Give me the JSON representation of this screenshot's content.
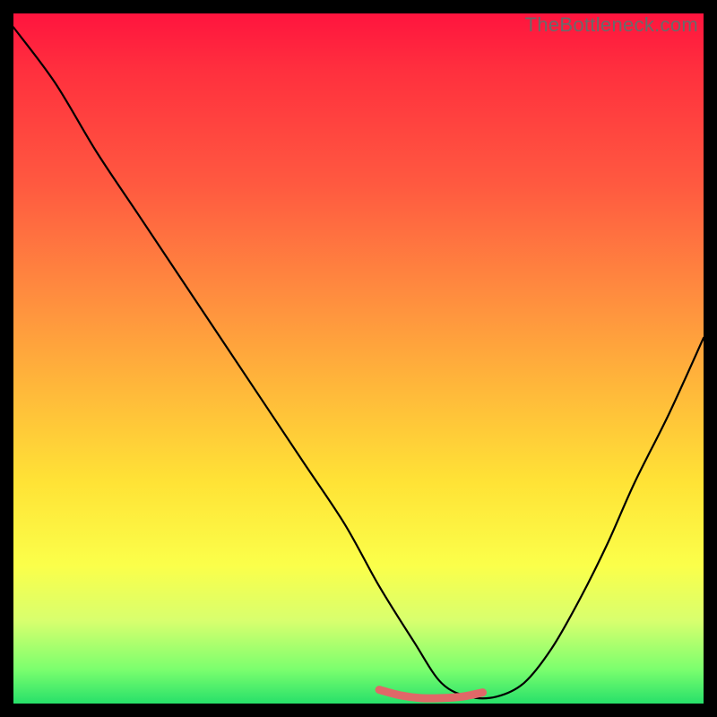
{
  "watermark": "TheBottleneck.com",
  "chart_data": {
    "type": "line",
    "title": "",
    "xlabel": "",
    "ylabel": "",
    "xlim": [
      0,
      100
    ],
    "ylim": [
      0,
      100
    ],
    "grid": false,
    "legend": false,
    "series": [
      {
        "name": "bottleneck-curve",
        "color": "#000000",
        "x": [
          0,
          6,
          12,
          18,
          24,
          30,
          36,
          42,
          48,
          53,
          58,
          62,
          66,
          70,
          74,
          78,
          82,
          86,
          90,
          95,
          100
        ],
        "values": [
          98,
          90,
          80,
          71,
          62,
          53,
          44,
          35,
          26,
          17,
          9,
          3,
          1,
          1,
          3,
          8,
          15,
          23,
          32,
          42,
          53
        ]
      },
      {
        "name": "optimal-basin",
        "color": "#e06868",
        "x": [
          53,
          56,
          59,
          62,
          65,
          68
        ],
        "values": [
          2,
          1.2,
          0.8,
          0.8,
          1.0,
          1.6
        ]
      }
    ],
    "gradient_stops": [
      {
        "pos": 0.0,
        "color": "#ff143e"
      },
      {
        "pos": 0.08,
        "color": "#ff2f3e"
      },
      {
        "pos": 0.25,
        "color": "#ff5a40"
      },
      {
        "pos": 0.4,
        "color": "#ff8a3f"
      },
      {
        "pos": 0.55,
        "color": "#ffba3a"
      },
      {
        "pos": 0.68,
        "color": "#ffe336"
      },
      {
        "pos": 0.8,
        "color": "#fbff4a"
      },
      {
        "pos": 0.88,
        "color": "#d8ff6e"
      },
      {
        "pos": 0.95,
        "color": "#7cff6e"
      },
      {
        "pos": 1.0,
        "color": "#27e06a"
      }
    ]
  }
}
